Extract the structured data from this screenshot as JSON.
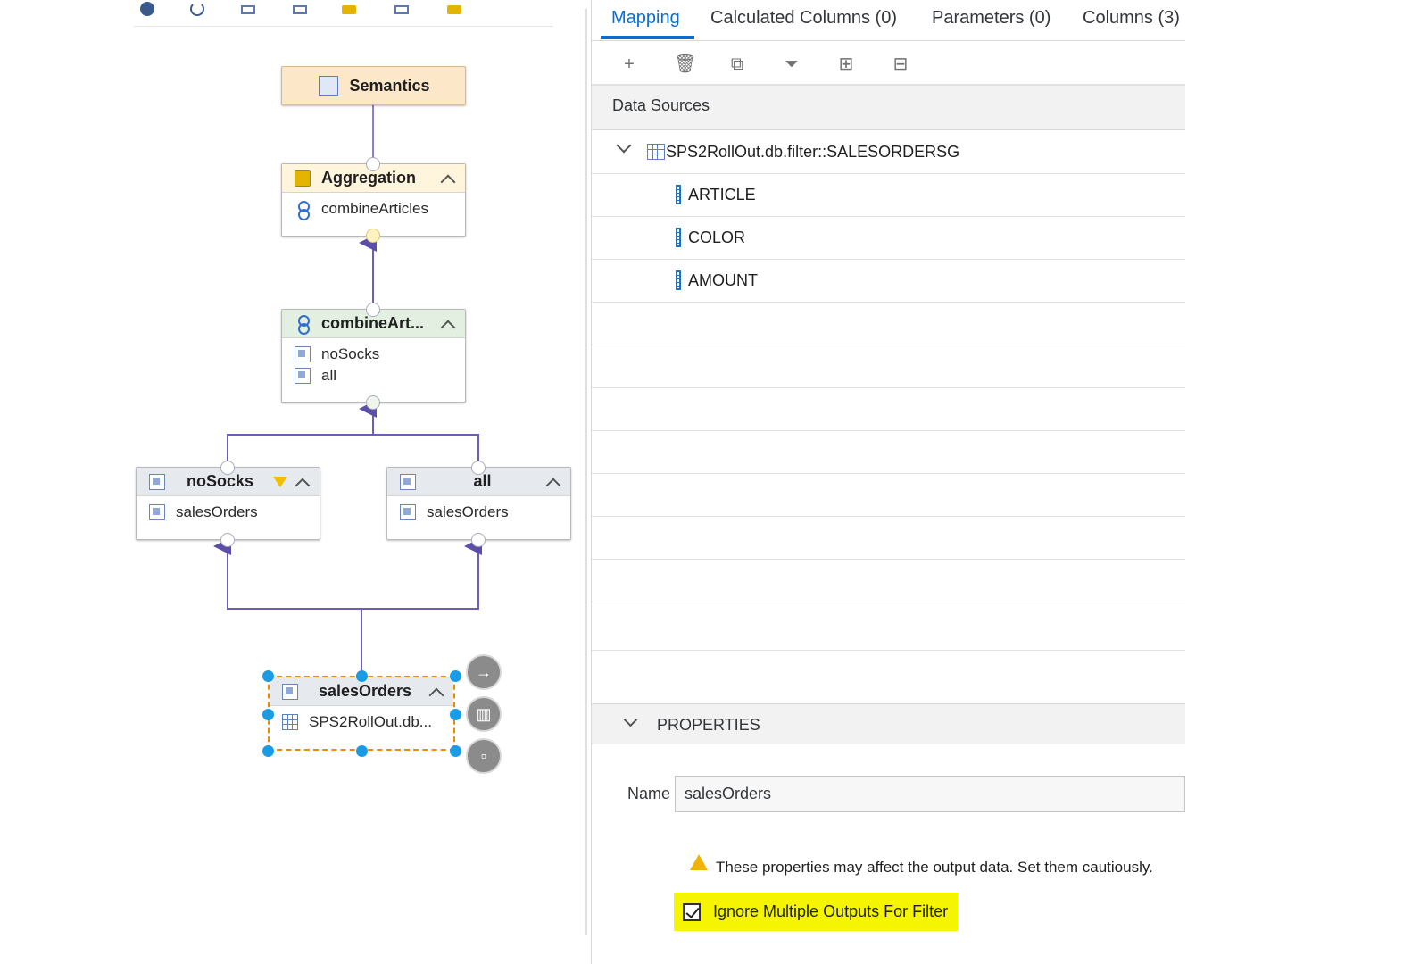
{
  "tabs": [
    {
      "label": "Mapping",
      "active": true
    },
    {
      "label": "Calculated Columns (0)",
      "active": false
    },
    {
      "label": "Parameters (0)",
      "active": false
    },
    {
      "label": "Columns (3)",
      "active": false
    }
  ],
  "toolbar": {
    "icons": [
      "add-icon",
      "delete-icon",
      "copy-icon",
      "filter-icon",
      "add-column-icon",
      "remove-column-icon"
    ]
  },
  "data_sources": {
    "header": "Data Sources",
    "source": "SPS2RollOut.db.filter::SALESORDERSG",
    "columns": [
      "ARTICLE",
      "COLOR",
      "AMOUNT"
    ]
  },
  "properties": {
    "header": "PROPERTIES",
    "name_label": "Name",
    "name_value": "salesOrders",
    "warning": "These properties may affect the output data. Set them cautiously.",
    "checkbox_label": "Ignore Multiple Outputs For Filter",
    "checkbox_checked": true,
    "highlight_color": "#f6f500"
  },
  "graph": {
    "semantics": {
      "title": "Semantics"
    },
    "aggregation": {
      "title": "Aggregation",
      "input": "combineArticles"
    },
    "union": {
      "title": "combineArt...",
      "inputs": [
        "noSocks",
        "all"
      ]
    },
    "nosocks": {
      "title": "noSocks",
      "input": "salesOrders"
    },
    "all": {
      "title": "all",
      "input": "salesOrders"
    },
    "salesorders": {
      "title": "salesOrders",
      "input": "SPS2RollOut.db..."
    }
  },
  "colors": {
    "accent": "#0a6ed1",
    "wire": "#6c5fb5",
    "selection": "#f08a00",
    "handle": "#1a9be6"
  }
}
